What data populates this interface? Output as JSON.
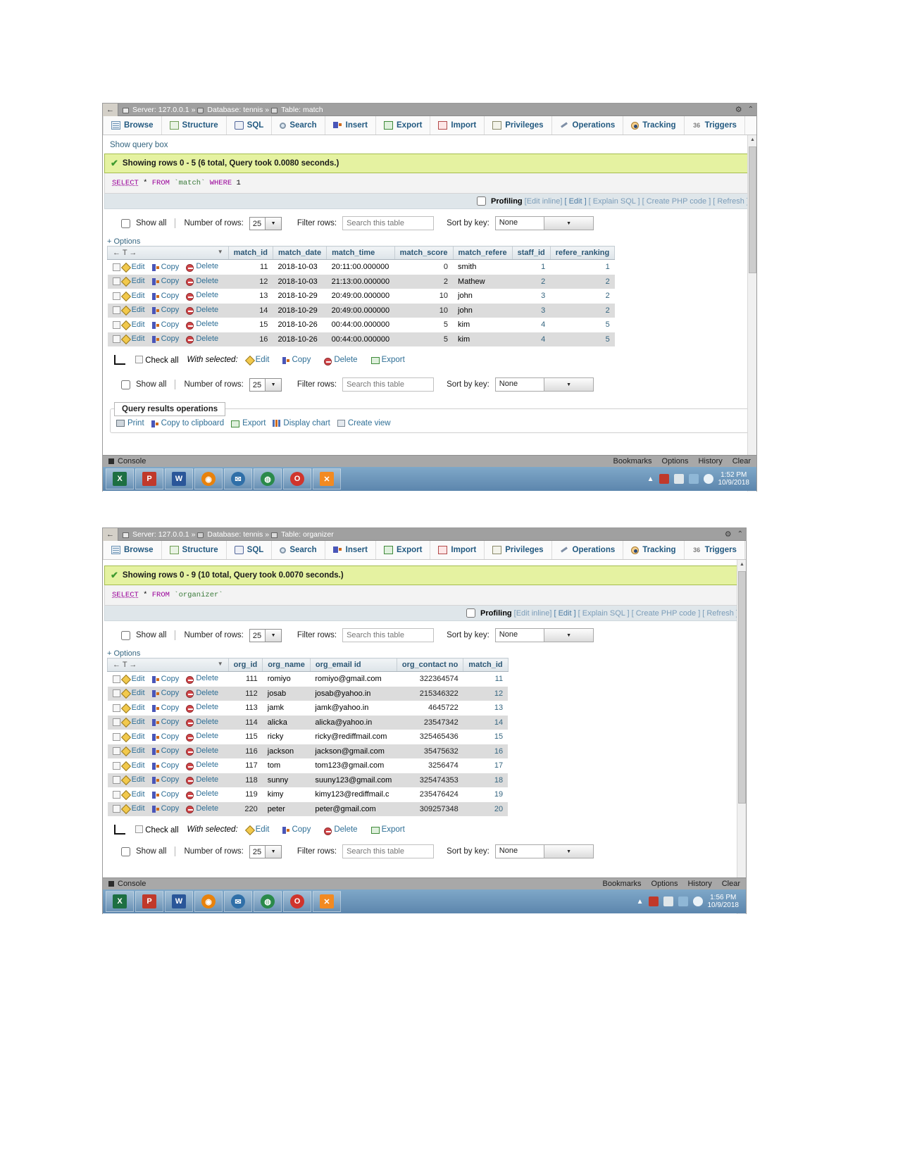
{
  "window1": {
    "titlebar": {
      "back": "←",
      "server_label": "Server: 127.0.0.1",
      "sep1": "»",
      "database_label": "Database: tennis",
      "sep2": "»",
      "table_label": "Table: match",
      "gear": "⚙",
      "minimize": "⌃"
    },
    "tabs": [
      {
        "label": "Browse",
        "icon": "browse-icon"
      },
      {
        "label": "Structure",
        "icon": "structure-icon"
      },
      {
        "label": "SQL",
        "icon": "sql-icon"
      },
      {
        "label": "Search",
        "icon": "search-icon"
      },
      {
        "label": "Insert",
        "icon": "insert-icon"
      },
      {
        "label": "Export",
        "icon": "export-icon"
      },
      {
        "label": "Import",
        "icon": "import-icon"
      },
      {
        "label": "Privileges",
        "icon": "privileges-icon"
      },
      {
        "label": "Operations",
        "icon": "operations-icon"
      },
      {
        "label": "Tracking",
        "icon": "tracking-icon"
      },
      {
        "label": "Triggers",
        "icon": "triggers-icon"
      }
    ],
    "show_query_box": "Show query box",
    "status": "Showing rows 0 - 5 (6 total, Query took 0.0080 seconds.)",
    "sql": {
      "select": "SELECT",
      "star": "*",
      "from": "FROM",
      "table": "`match`",
      "where": "WHERE",
      "one": "1"
    },
    "profiling": {
      "label": "Profiling",
      "edit_inline": "[Edit inline]",
      "edit": "[ Edit ]",
      "explain": "[ Explain SQL ]",
      "create_php": "[ Create PHP code ]",
      "refresh": "[ Refresh ]"
    },
    "controls": {
      "show_all": "Show all",
      "number_of_rows_label": "Number of rows:",
      "number_of_rows_value": "25",
      "filter_rows_label": "Filter rows:",
      "filter_placeholder": "Search this table",
      "sort_by_key_label": "Sort by key:",
      "sort_by_key_value": "None"
    },
    "options_link": "+ Options",
    "table": {
      "sort_header": "← T →",
      "columns": [
        "match_id",
        "match_date",
        "match_time",
        "match_score",
        "match_refere",
        "staff_id",
        "refere_ranking"
      ],
      "row_actions": {
        "edit": "Edit",
        "copy": "Copy",
        "delete": "Delete"
      },
      "rows": [
        {
          "match_id": "11",
          "match_date": "2018-10-03",
          "match_time": "20:11:00.000000",
          "match_score": "0",
          "match_refere": "smith",
          "staff_id": "1",
          "refere_ranking": "1"
        },
        {
          "match_id": "12",
          "match_date": "2018-10-03",
          "match_time": "21:13:00.000000",
          "match_score": "2",
          "match_refere": "Mathew",
          "staff_id": "2",
          "refere_ranking": "2"
        },
        {
          "match_id": "13",
          "match_date": "2018-10-29",
          "match_time": "20:49:00.000000",
          "match_score": "10",
          "match_refere": "john",
          "staff_id": "3",
          "refere_ranking": "2"
        },
        {
          "match_id": "14",
          "match_date": "2018-10-29",
          "match_time": "20:49:00.000000",
          "match_score": "10",
          "match_refere": "john",
          "staff_id": "3",
          "refere_ranking": "2"
        },
        {
          "match_id": "15",
          "match_date": "2018-10-26",
          "match_time": "00:44:00.000000",
          "match_score": "5",
          "match_refere": "kim",
          "staff_id": "4",
          "refere_ranking": "5"
        },
        {
          "match_id": "16",
          "match_date": "2018-10-26",
          "match_time": "00:44:00.000000",
          "match_score": "5",
          "match_refere": "kim",
          "staff_id": "4",
          "refere_ranking": "5"
        }
      ]
    },
    "withselected": {
      "check_all": "Check all",
      "label": "With selected:",
      "edit": "Edit",
      "copy": "Copy",
      "delete": "Delete",
      "export": "Export"
    },
    "query_results_operations": {
      "legend": "Query results operations",
      "print": "Print",
      "copy_to_clipboard": "Copy to clipboard",
      "export": "Export",
      "display_chart": "Display chart",
      "create_view": "Create view"
    },
    "console": {
      "label": "Console",
      "bookmarks": "Bookmarks",
      "options": "Options",
      "history": "History",
      "clear": "Clear"
    },
    "taskbar": {
      "apps": [
        {
          "name": "excel",
          "glyph": "X",
          "color": "#1d6f42"
        },
        {
          "name": "powerpoint",
          "glyph": "P",
          "color": "#c0392b"
        },
        {
          "name": "word",
          "glyph": "W",
          "color": "#2a5699"
        },
        {
          "name": "firefox",
          "glyph": "◉",
          "color": "#e8820c"
        },
        {
          "name": "thunderbird",
          "glyph": "✉",
          "color": "#2f6fa8"
        },
        {
          "name": "chrome",
          "glyph": "◍",
          "color": "#2a8a4a"
        },
        {
          "name": "opera",
          "glyph": "O",
          "color": "#d0342c"
        },
        {
          "name": "xampp",
          "glyph": "✕",
          "color": "#f28a21"
        }
      ],
      "clock_time": "1:52 PM",
      "clock_date": "10/9/2018"
    }
  },
  "window2": {
    "titlebar": {
      "back": "←",
      "server_label": "Server: 127.0.0.1",
      "sep1": "»",
      "database_label": "Database: tennis",
      "sep2": "»",
      "table_label": "Table: organizer",
      "gear": "⚙",
      "minimize": "⌃"
    },
    "tabs": [
      {
        "label": "Browse",
        "icon": "browse-icon"
      },
      {
        "label": "Structure",
        "icon": "structure-icon"
      },
      {
        "label": "SQL",
        "icon": "sql-icon"
      },
      {
        "label": "Search",
        "icon": "search-icon"
      },
      {
        "label": "Insert",
        "icon": "insert-icon"
      },
      {
        "label": "Export",
        "icon": "export-icon"
      },
      {
        "label": "Import",
        "icon": "import-icon"
      },
      {
        "label": "Privileges",
        "icon": "privileges-icon"
      },
      {
        "label": "Operations",
        "icon": "operations-icon"
      },
      {
        "label": "Tracking",
        "icon": "tracking-icon"
      },
      {
        "label": "Triggers",
        "icon": "triggers-icon"
      }
    ],
    "status": "Showing rows 0 - 9 (10 total, Query took 0.0070 seconds.)",
    "sql": {
      "select": "SELECT",
      "star": "*",
      "from": "FROM",
      "table": "`organizer`"
    },
    "profiling": {
      "label": "Profiling",
      "edit_inline": "[Edit inline]",
      "edit": "[ Edit ]",
      "explain": "[ Explain SQL ]",
      "create_php": "[ Create PHP code ]",
      "refresh": "[ Refresh ]"
    },
    "controls": {
      "show_all": "Show all",
      "number_of_rows_label": "Number of rows:",
      "number_of_rows_value": "25",
      "filter_rows_label": "Filter rows:",
      "filter_placeholder": "Search this table",
      "sort_by_key_label": "Sort by key:",
      "sort_by_key_value": "None"
    },
    "options_link": "+ Options",
    "table": {
      "sort_header": "← T →",
      "columns": [
        "org_id",
        "org_name",
        "org_email id",
        "org_contact no",
        "match_id"
      ],
      "row_actions": {
        "edit": "Edit",
        "copy": "Copy",
        "delete": "Delete"
      },
      "rows": [
        {
          "org_id": "111",
          "org_name": "romiyo",
          "org_email": "romiyo@gmail.com",
          "org_contact": "322364574",
          "match_id": "11"
        },
        {
          "org_id": "112",
          "org_name": "josab",
          "org_email": "josab@yahoo.in",
          "org_contact": "215346322",
          "match_id": "12"
        },
        {
          "org_id": "113",
          "org_name": "jamk",
          "org_email": "jamk@yahoo.in",
          "org_contact": "4645722",
          "match_id": "13"
        },
        {
          "org_id": "114",
          "org_name": "alicka",
          "org_email": "alicka@yahoo.in",
          "org_contact": "23547342",
          "match_id": "14"
        },
        {
          "org_id": "115",
          "org_name": "ricky",
          "org_email": "ricky@rediffmail.com",
          "org_contact": "325465436",
          "match_id": "15"
        },
        {
          "org_id": "116",
          "org_name": "jackson",
          "org_email": "jackson@gmail.com",
          "org_contact": "35475632",
          "match_id": "16"
        },
        {
          "org_id": "117",
          "org_name": "tom",
          "org_email": "tom123@gmail.com",
          "org_contact": "3256474",
          "match_id": "17"
        },
        {
          "org_id": "118",
          "org_name": "sunny",
          "org_email": "suuny123@gmail.com",
          "org_contact": "325474353",
          "match_id": "18"
        },
        {
          "org_id": "119",
          "org_name": "kimy",
          "org_email": "kimy123@rediffmail.c",
          "org_contact": "235476424",
          "match_id": "19"
        },
        {
          "org_id": "220",
          "org_name": "peter",
          "org_email": "peter@gmail.com",
          "org_contact": "309257348",
          "match_id": "20"
        }
      ]
    },
    "withselected": {
      "check_all": "Check all",
      "label": "With selected:",
      "edit": "Edit",
      "copy": "Copy",
      "delete": "Delete",
      "export": "Export"
    },
    "console": {
      "label": "Console",
      "bookmarks": "Bookmarks",
      "options": "Options",
      "history": "History",
      "clear": "Clear"
    },
    "taskbar": {
      "apps": [
        {
          "name": "excel",
          "glyph": "X",
          "color": "#1d6f42"
        },
        {
          "name": "powerpoint",
          "glyph": "P",
          "color": "#c0392b"
        },
        {
          "name": "word",
          "glyph": "W",
          "color": "#2a5699"
        },
        {
          "name": "firefox",
          "glyph": "◉",
          "color": "#e8820c"
        },
        {
          "name": "thunderbird",
          "glyph": "✉",
          "color": "#2f6fa8"
        },
        {
          "name": "chrome",
          "glyph": "◍",
          "color": "#2a8a4a"
        },
        {
          "name": "opera",
          "glyph": "O",
          "color": "#d0342c"
        },
        {
          "name": "xampp",
          "glyph": "✕",
          "color": "#f28a21"
        }
      ],
      "clock_time": "1:56 PM",
      "clock_date": "10/9/2018"
    }
  }
}
